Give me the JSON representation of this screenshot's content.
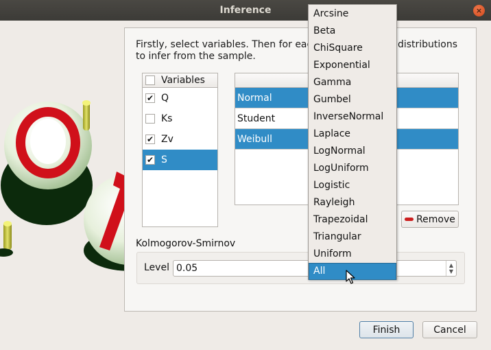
{
  "window": {
    "title": "Inference",
    "close_icon": "close-icon"
  },
  "intro_text": "Firstly, select variables. Then for each variable, select distributions to infer from the sample.",
  "variables": {
    "header": "Variables",
    "header_checked": false,
    "items": [
      {
        "label": "Q",
        "checked": true,
        "selected": false
      },
      {
        "label": "Ks",
        "checked": false,
        "selected": false
      },
      {
        "label": "Zv",
        "checked": true,
        "selected": false
      },
      {
        "label": "S",
        "checked": true,
        "selected": true
      }
    ]
  },
  "distributions": {
    "header": "",
    "items": [
      {
        "label": "Normal",
        "selected": true
      },
      {
        "label": "Student",
        "selected": false
      },
      {
        "label": "Weibull",
        "selected": true
      }
    ]
  },
  "remove_button": {
    "label": "Remove",
    "icon": "minus-icon"
  },
  "ks_test": {
    "title": "Kolmogorov-Smirnov",
    "level_label": "Level",
    "level_value": "0.05"
  },
  "add_dropdown": {
    "items": [
      "Arcsine",
      "Beta",
      "ChiSquare",
      "Exponential",
      "Gamma",
      "Gumbel",
      "InverseNormal",
      "Laplace",
      "LogNormal",
      "LogUniform",
      "Logistic",
      "Rayleigh",
      "Trapezoidal",
      "Triangular",
      "Uniform",
      "All"
    ],
    "highlighted": "All"
  },
  "footer": {
    "finish_label": "Finish",
    "cancel_label": "Cancel"
  },
  "colors": {
    "selection": "#308cc6",
    "remove_icon": "#cc1f1f",
    "titlebar": "#3c3b37"
  }
}
